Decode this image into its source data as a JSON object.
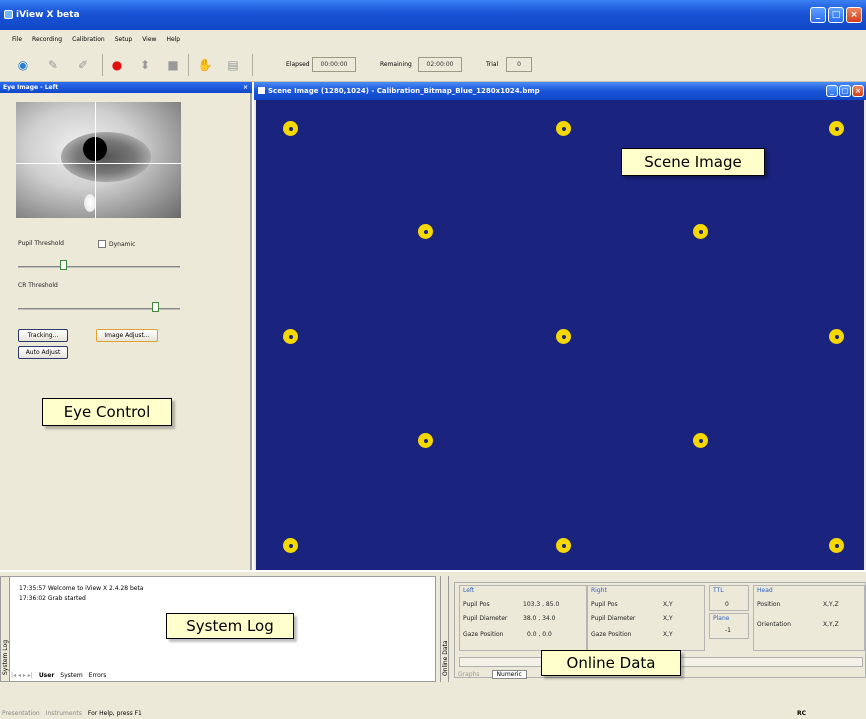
{
  "app": {
    "title": "iView X beta"
  },
  "menu": [
    "File",
    "Recording",
    "Calibration",
    "Setup",
    "View",
    "Help"
  ],
  "toolbar": {
    "elapsed_label": "Elapsed",
    "elapsed_value": "00:00:00",
    "remaining_label": "Remaining",
    "remaining_value": "02:00:00",
    "trial_label": "Trial",
    "trial_value": "0"
  },
  "eye_panel": {
    "title": "Eye Image - Left",
    "close": "×",
    "pupil_threshold_label": "Pupil Threshold",
    "dynamic_label": "Dynamic",
    "cr_threshold_label": "CR Threshold",
    "pupil_threshold_level": 0.28,
    "cr_threshold_level": 0.85,
    "tracking_button": "Tracking...",
    "image_adjust_button": "Image Adjust...",
    "auto_adjust_button": "Auto Adjust"
  },
  "scene": {
    "title": "Scene Image (1280,1024) - Calibration_Bitmap_Blue_1280x1024.bmp",
    "background": "#1a237e",
    "dot_color": "#f5d800"
  },
  "log": {
    "side_label": "System Log",
    "lines": [
      "17:35:57  Welcome to iView X 2.4.28 beta",
      "17:36:02  Grab started"
    ],
    "tabs": [
      "User",
      "System",
      "Errors"
    ]
  },
  "online": {
    "side_label": "Online Data",
    "left": {
      "header": "Left",
      "rows": [
        [
          "Pupil Pos",
          "103.3 , 85.0"
        ],
        [
          "Pupil Diameter",
          "38.0 , 34.0"
        ],
        [
          "Gaze Position",
          "0.0 , 0.0"
        ]
      ]
    },
    "right": {
      "header": "Right",
      "rows": [
        [
          "Pupil Pos",
          "X,Y"
        ],
        [
          "Pupil Diameter",
          "X,Y"
        ],
        [
          "Gaze Position",
          "X,Y"
        ]
      ]
    },
    "ttl": {
      "header": "TTL",
      "value": "0"
    },
    "plane": {
      "header": "Plane",
      "value": "-1"
    },
    "head": {
      "header": "Head",
      "rows": [
        [
          "Position",
          "X,Y,Z"
        ],
        [
          "Orientation",
          "X,Y,Z"
        ]
      ]
    },
    "tabs": [
      "Graphs",
      "Numeric"
    ]
  },
  "status": {
    "left1": "Presentation",
    "left2": "Instruments",
    "help": "For Help, press F1",
    "right": "RC"
  },
  "callouts": {
    "scene": "Scene Image",
    "eye": "Eye Control",
    "log": "System Log",
    "online": "Online Data"
  }
}
